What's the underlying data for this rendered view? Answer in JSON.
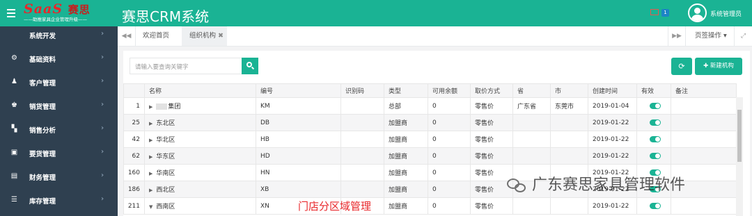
{
  "header": {
    "logo_main": "SaaS",
    "logo_cn": "赛思",
    "logo_tagline": "——助推家具企业管理升级——",
    "app_title": "赛思CRM系统",
    "mail_count": "1",
    "user_name": "系统管理员",
    "accent_color": "#1ab394"
  },
  "sidebar": {
    "items": [
      {
        "label": "系统开发",
        "icon": "code-icon"
      },
      {
        "label": "基础资料",
        "icon": "gears-icon"
      },
      {
        "label": "客户管理",
        "icon": "user-icon"
      },
      {
        "label": "销货管理",
        "icon": "user-tie-icon"
      },
      {
        "label": "销售分析",
        "icon": "cart-icon"
      },
      {
        "label": "要货管理",
        "icon": "bus-icon"
      },
      {
        "label": "财务管理",
        "icon": "money-icon"
      },
      {
        "label": "库存管理",
        "icon": "list-icon"
      }
    ]
  },
  "tabs": {
    "items": [
      "欢迎首页",
      "组织机构"
    ],
    "active": "组织机构",
    "page_ops": "页签操作"
  },
  "toolbar": {
    "search_placeholder": "请输入要查询关键字",
    "new_button": "新建机构"
  },
  "table": {
    "columns": [
      "名称",
      "编号",
      "识别码",
      "类型",
      "可用余额",
      "取价方式",
      "省",
      "市",
      "创建时间",
      "有效",
      "备注"
    ],
    "rows": [
      {
        "id": "1",
        "name": "集团",
        "code": "KM",
        "ident": "",
        "type": "总部",
        "balance": "0",
        "price": "零售价",
        "province": "广东省",
        "city": "东莞市",
        "created": "2019-01-04",
        "valid": true,
        "note": "",
        "expanded": false
      },
      {
        "id": "25",
        "name": "东北区",
        "code": "DB",
        "ident": "",
        "type": "加盟商",
        "balance": "0",
        "price": "零售价",
        "province": "",
        "city": "",
        "created": "2019-01-22",
        "valid": true,
        "note": "",
        "expanded": false
      },
      {
        "id": "42",
        "name": "华北区",
        "code": "HB",
        "ident": "",
        "type": "加盟商",
        "balance": "0",
        "price": "零售价",
        "province": "",
        "city": "",
        "created": "2019-01-22",
        "valid": true,
        "note": "",
        "expanded": false
      },
      {
        "id": "62",
        "name": "华东区",
        "code": "HD",
        "ident": "",
        "type": "加盟商",
        "balance": "0",
        "price": "零售价",
        "province": "",
        "city": "",
        "created": "2019-01-22",
        "valid": true,
        "note": "",
        "expanded": false
      },
      {
        "id": "160",
        "name": "华南区",
        "code": "HN",
        "ident": "",
        "type": "加盟商",
        "balance": "0",
        "price": "零售价",
        "province": "",
        "city": "",
        "created": "2019-01-22",
        "valid": true,
        "note": "",
        "expanded": false
      },
      {
        "id": "186",
        "name": "西北区",
        "code": "XB",
        "ident": "",
        "type": "加盟商",
        "balance": "0",
        "price": "零售价",
        "province": "",
        "city": "",
        "created": "2019-01-22",
        "valid": true,
        "note": "",
        "expanded": false
      },
      {
        "id": "211",
        "name": "西南区",
        "code": "XN",
        "ident": "",
        "type": "加盟商",
        "balance": "0",
        "price": "零售价",
        "province": "",
        "city": "",
        "created": "2019-01-22",
        "valid": true,
        "note": "",
        "expanded": true
      }
    ]
  },
  "annotation": "门店分区域管理",
  "watermark": "广东赛思家具管理软件"
}
